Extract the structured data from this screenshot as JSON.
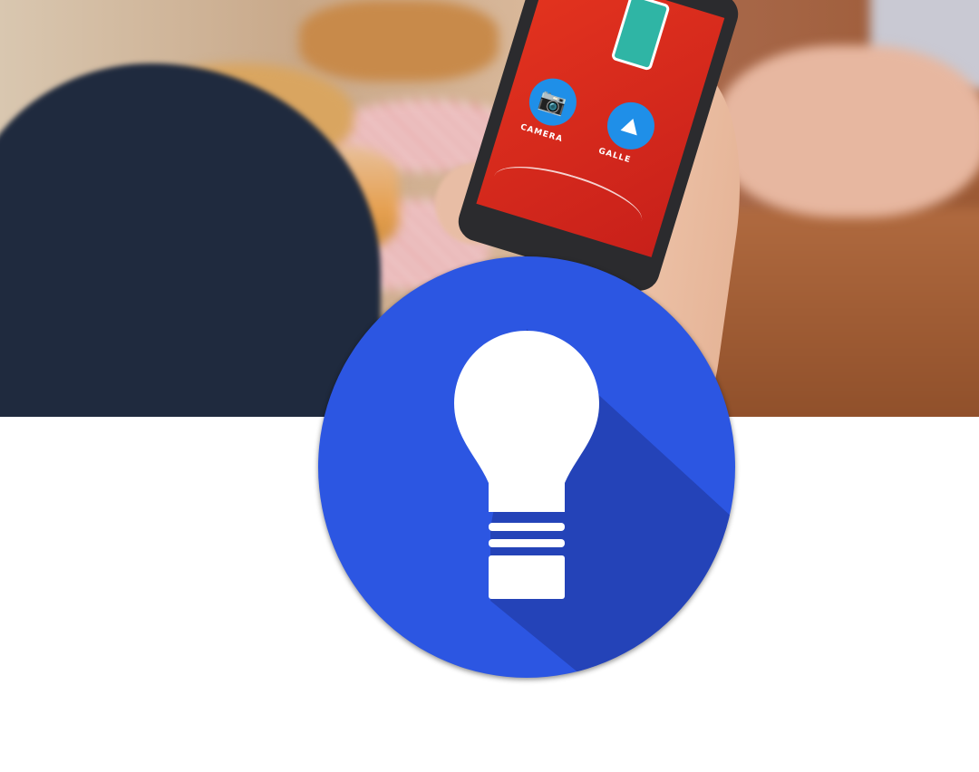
{
  "photo": {
    "phone_app": {
      "camera_label": "CAMERA",
      "gallery_label": "GALLE",
      "camera_icon": "camera-icon",
      "gallery_icon": "image-icon"
    }
  },
  "badge": {
    "icon": "lightbulb-icon",
    "colors": {
      "circle": "#2c56e2",
      "shadow": "#2443b8",
      "bulb": "#ffffff"
    }
  }
}
